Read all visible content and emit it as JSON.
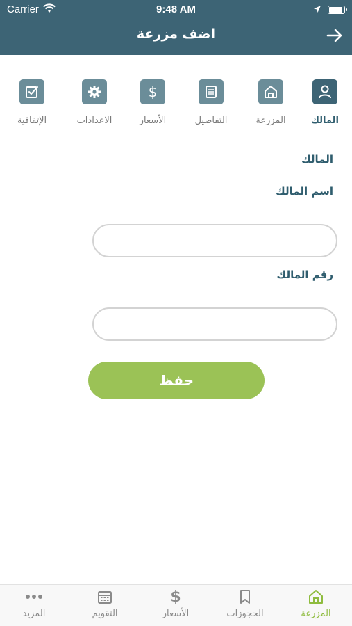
{
  "status_bar": {
    "carrier": "Carrier",
    "time": "9:48 AM"
  },
  "header": {
    "title": "اضف مزرعة"
  },
  "steps": [
    {
      "label": "المالك",
      "icon": "person-icon",
      "active": true
    },
    {
      "label": "المزرعة",
      "icon": "house-icon",
      "active": false
    },
    {
      "label": "التفاصيل",
      "icon": "list-icon",
      "active": false
    },
    {
      "label": "الأسعار",
      "icon": "dollar-icon",
      "active": false
    },
    {
      "label": "الاعدادات",
      "icon": "gear-icon",
      "active": false
    },
    {
      "label": "الإتفاقية",
      "icon": "checkbox-icon",
      "active": false
    }
  ],
  "form": {
    "section_title": "المالك",
    "owner_name_label": "اسم المالك",
    "owner_name_value": "",
    "owner_number_label": "رقم المالك",
    "owner_number_value": "",
    "save_label": "حفظ"
  },
  "tabbar": [
    {
      "label": "المزرعة",
      "icon": "house-icon",
      "active": true
    },
    {
      "label": "الحجوزات",
      "icon": "bookmark-icon",
      "active": false
    },
    {
      "label": "الأسعار",
      "icon": "dollar-icon",
      "active": false
    },
    {
      "label": "التقويم",
      "icon": "calendar-icon",
      "active": false
    },
    {
      "label": "المزيد",
      "icon": "more-icon",
      "active": false
    }
  ],
  "colors": {
    "header": "#3d6475",
    "accent": "#9bc256",
    "icon_bg": "#6b8d99",
    "active_tab": "#8fbc3f"
  }
}
